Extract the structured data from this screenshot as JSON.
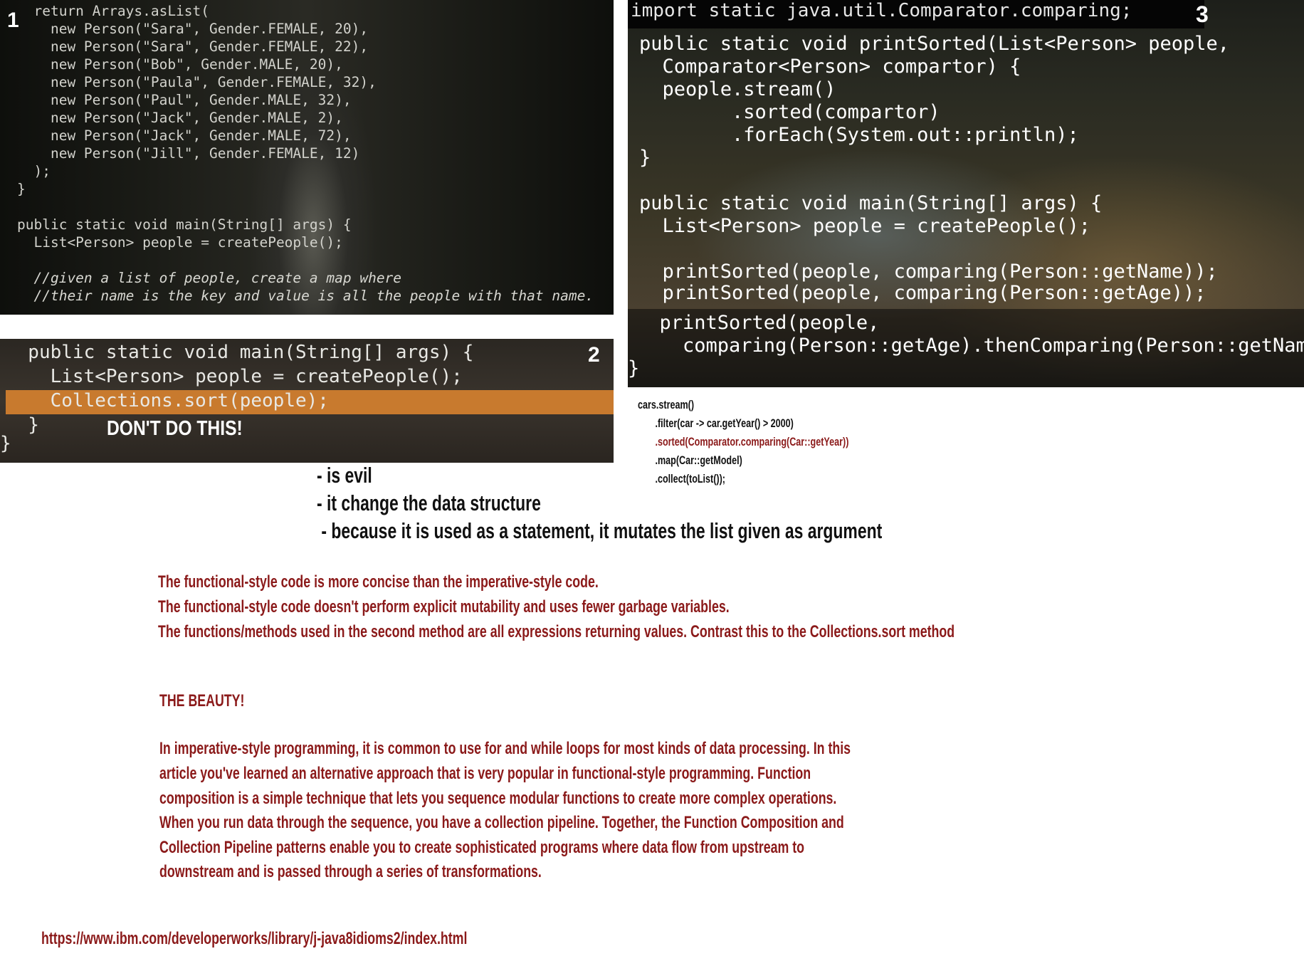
{
  "panel1": {
    "number": "1",
    "lines": [
      "  return Arrays.asList(",
      "    new Person(\"Sara\", Gender.FEMALE, 20),",
      "    new Person(\"Sara\", Gender.FEMALE, 22),",
      "    new Person(\"Bob\", Gender.MALE, 20),",
      "    new Person(\"Paula\", Gender.FEMALE, 32),",
      "    new Person(\"Paul\", Gender.MALE, 32),",
      "    new Person(\"Jack\", Gender.MALE, 2),",
      "    new Person(\"Jack\", Gender.MALE, 72),",
      "    new Person(\"Jill\", Gender.FEMALE, 12)",
      "  );",
      "}",
      "",
      "public static void main(String[] args) {",
      "  List<Person> people = createPeople();",
      "",
      "  //given a list of people, create a map where",
      "  //their name is the key and value is all the people with that name."
    ]
  },
  "panel2": {
    "number": "2",
    "lines": [
      "  public static void main(String[] args) {",
      "    List<Person> people = createPeople();",
      "    Collections.sort(people);",
      "  }",
      "}"
    ],
    "warning": "DON'T DO THIS!"
  },
  "panel3": {
    "number": "3",
    "import_line": "import static java.util.Comparator.comparing;",
    "lines": [
      "public static void printSorted(List<Person> people,",
      "  Comparator<Person> compartor) {",
      "  people.stream()",
      "        .sorted(compartor)",
      "        .forEach(System.out::println);",
      "}",
      "",
      "public static void main(String[] args) {",
      "  List<Person> people = createPeople();",
      "",
      "  printSorted(people, comparing(Person::getName));",
      "  printSorted(people, comparing(Person::getAge));"
    ],
    "lines2": [
      "  printSorted(people,",
      "    comparing(Person::getAge).thenComparing(Person::getName));",
      "}"
    ]
  },
  "cars_code": {
    "line1": "cars.stream()",
    "line2": "       .filter(car -> car.getYear() > 2000)",
    "line3": "       .sorted(Comparator.comparing(Car::getYear))",
    "line4": "       .map(Car::getModel)",
    "line5": "       .collect(toList());"
  },
  "notes": {
    "line1": "- is evil",
    "line2": "- it change the data structure",
    "line3": " - because it is used as a statement, it mutates the list given as argument"
  },
  "comparison": {
    "line1": "The functional-style code is more concise than the imperative-style code.",
    "line2": "The functional-style code doesn't perform explicit mutability and uses fewer garbage variables.",
    "line3": "The functions/methods used in the second method are all expressions returning values. Contrast this to the Collections.sort method"
  },
  "beauty": {
    "heading": "THE BEAUTY!",
    "lines": [
      "In imperative-style programming, it is common to use for and while loops for most kinds of data processing. In this",
      "article you've learned an alternative approach that is very popular in functional-style programming. Function",
      "composition is a simple technique that lets you sequence modular functions to create more complex operations.",
      "When you run data through the sequence, you have a collection pipeline. Together, the Function Composition and",
      "Collection Pipeline patterns enable you to create sophisticated programs where data flow from upstream to",
      "downstream and is passed through a series of transformations."
    ]
  },
  "link": "https://www.ibm.com/developerworks/library/j-java8idioms2/index.html",
  "colors": {
    "text_red": "#8b1a1a",
    "text_black": "#111111",
    "highlight_orange": "#c87a2e"
  }
}
